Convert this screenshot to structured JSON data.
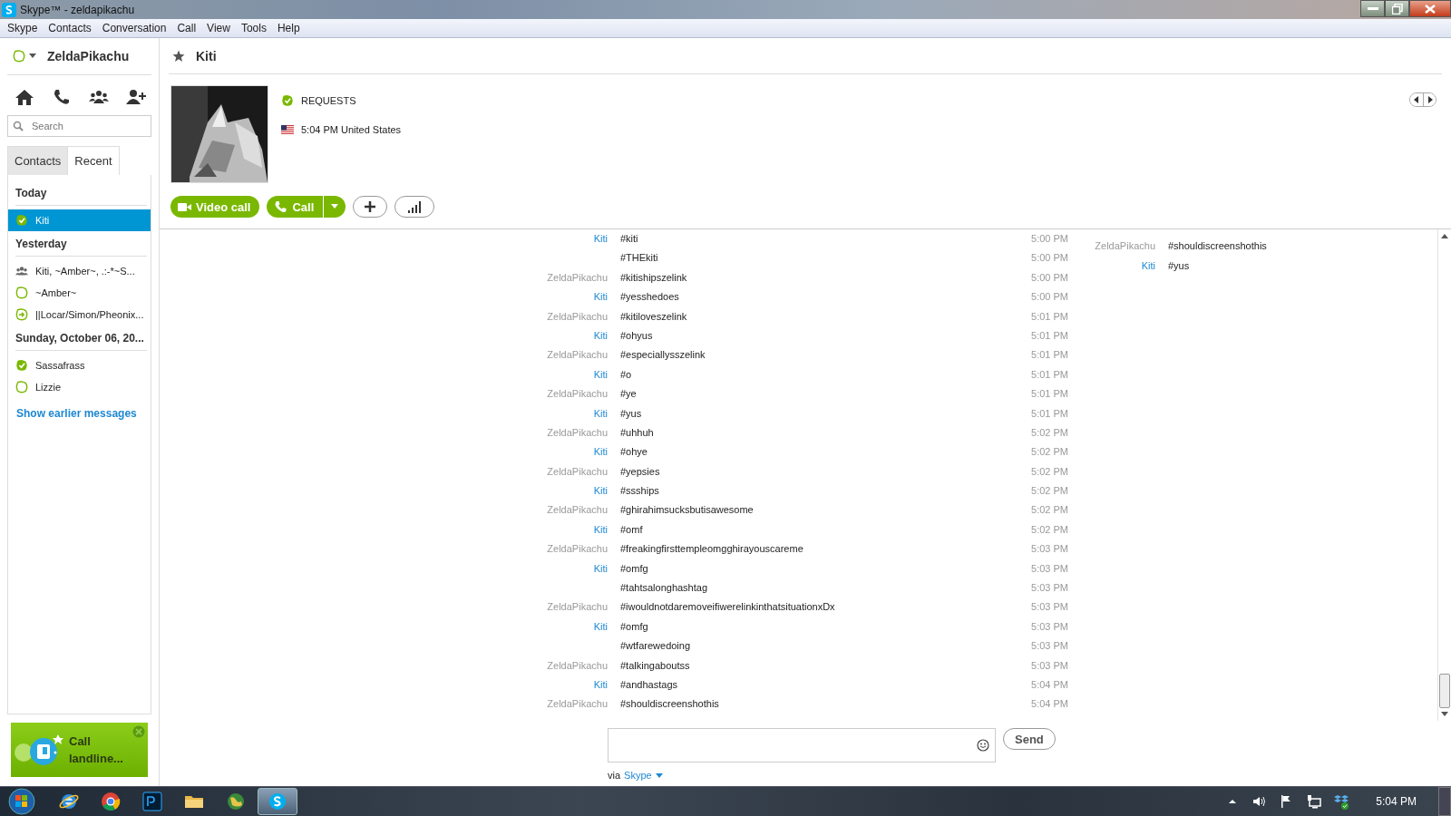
{
  "window": {
    "title": "Skype™ - zeldapikachu"
  },
  "menu": [
    "Skype",
    "Contacts",
    "Conversation",
    "Call",
    "View",
    "Tools",
    "Help"
  ],
  "sidebar": {
    "user": "ZeldaPikachu",
    "search": {
      "placeholder": "Search"
    },
    "tabs": [
      {
        "label": "Contacts",
        "selected": false
      },
      {
        "label": "Recent",
        "selected": true
      }
    ],
    "groups": [
      {
        "heading": "Today",
        "items": [
          {
            "name": "Kiti",
            "kind": "online",
            "selected": true
          }
        ]
      },
      {
        "heading": "Yesterday",
        "items": [
          {
            "name": "Kiti, ~Amber~, .:-*~S...",
            "kind": "group",
            "selected": false
          },
          {
            "name": "~Amber~",
            "kind": "offline",
            "selected": false
          },
          {
            "name": "||Locar/Simon/Pheonix...",
            "kind": "forward",
            "selected": false
          }
        ]
      },
      {
        "heading": "Sunday, October 06, 20...",
        "items": [
          {
            "name": "Sassafrass",
            "kind": "online",
            "selected": false
          },
          {
            "name": "Lizzie",
            "kind": "offline",
            "selected": false
          }
        ]
      }
    ],
    "show_earlier": "Show earlier messages",
    "promo": {
      "text": "Call landline..."
    }
  },
  "conversation": {
    "title": "Kiti",
    "mood": "REQUESTS",
    "local_time": "5:04 PM United States",
    "video_button": "Video call",
    "call_button": "Call",
    "messages": [
      {
        "sender": "Kiti",
        "self": false,
        "text": "#kiti",
        "time": "5:00 PM"
      },
      {
        "text": "#THEkiti",
        "time": "5:00 PM"
      },
      {
        "sender": "ZeldaPikachu",
        "self": true,
        "text": "#kitishipszelink",
        "time": "5:00 PM"
      },
      {
        "sender": "Kiti",
        "self": false,
        "text": "#yesshedoes",
        "time": "5:00 PM"
      },
      {
        "sender": "ZeldaPikachu",
        "self": true,
        "text": "#kitiloveszelink",
        "time": "5:01 PM"
      },
      {
        "sender": "Kiti",
        "self": false,
        "text": "#ohyus",
        "time": "5:01 PM"
      },
      {
        "sender": "ZeldaPikachu",
        "self": true,
        "text": "#especiallysszelink",
        "time": "5:01 PM"
      },
      {
        "sender": "Kiti",
        "self": false,
        "text": "#o",
        "time": "5:01 PM"
      },
      {
        "sender": "ZeldaPikachu",
        "self": true,
        "text": "#ye",
        "time": "5:01 PM"
      },
      {
        "sender": "Kiti",
        "self": false,
        "text": "#yus",
        "time": "5:01 PM"
      },
      {
        "sender": "ZeldaPikachu",
        "self": true,
        "text": "#uhhuh",
        "time": "5:02 PM"
      },
      {
        "sender": "Kiti",
        "self": false,
        "text": "#ohye",
        "time": "5:02 PM"
      },
      {
        "sender": "ZeldaPikachu",
        "self": true,
        "text": "#yepsies",
        "time": "5:02 PM"
      },
      {
        "sender": "Kiti",
        "self": false,
        "text": "#ssships",
        "time": "5:02 PM"
      },
      {
        "sender": "ZeldaPikachu",
        "self": true,
        "text": "#ghirahimsucksbutisawesome",
        "time": "5:02 PM"
      },
      {
        "sender": "Kiti",
        "self": false,
        "text": "#omf",
        "time": "5:02 PM"
      },
      {
        "sender": "ZeldaPikachu",
        "self": true,
        "text": "#freakingfirsttempleomgghirayouscareme",
        "time": "5:03 PM"
      },
      {
        "sender": "Kiti",
        "self": false,
        "text": "#omfg",
        "time": "5:03 PM"
      },
      {
        "text": "#tahtsalonghashtag",
        "time": "5:03 PM"
      },
      {
        "sender": "ZeldaPikachu",
        "self": true,
        "text": "#iwouldnotdaremoveifiwerelinkinthatsituationxDx",
        "time": "5:03 PM"
      },
      {
        "sender": "Kiti",
        "self": false,
        "text": "#omfg",
        "time": "5:03 PM"
      },
      {
        "text": "#wtfarewedoing",
        "time": "5:03 PM"
      },
      {
        "sender": "ZeldaPikachu",
        "self": true,
        "text": "#talkingaboutss",
        "time": "5:03 PM"
      },
      {
        "sender": "Kiti",
        "self": false,
        "text": "#andhastags",
        "time": "5:04 PM"
      },
      {
        "sender": "ZeldaPikachu",
        "self": true,
        "text": "#shouldiscreenshothis",
        "time": "5:04 PM"
      }
    ],
    "side_messages": [
      {
        "sender": "ZeldaPikachu",
        "self": true,
        "text": "#shouldiscreenshothis"
      },
      {
        "sender": "Kiti",
        "self": false,
        "text": "#yus"
      }
    ],
    "send_button": "Send",
    "via": "via",
    "via_link": "Skype"
  },
  "taskbar": {
    "apps": [
      {
        "kind": "ie",
        "selected": false
      },
      {
        "kind": "chrome",
        "selected": false
      },
      {
        "kind": "photoshop",
        "selected": false
      },
      {
        "kind": "folder",
        "selected": false
      },
      {
        "kind": "globe",
        "selected": false
      },
      {
        "kind": "skype",
        "selected": true
      }
    ],
    "tray": [
      {
        "kind": "arrow"
      },
      {
        "kind": "speaker"
      },
      {
        "kind": "flag"
      },
      {
        "kind": "network"
      },
      {
        "kind": "dropbox"
      }
    ],
    "clock": "5:04 PM"
  }
}
